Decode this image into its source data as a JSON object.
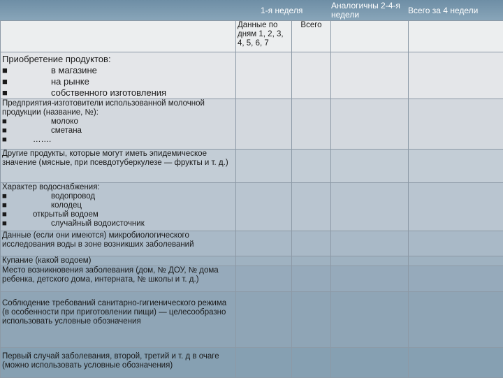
{
  "header": {
    "week1": "1-я неделя",
    "weeks2_4": "Аналогичны 2-4-я недели",
    "total4": "Всего за 4 недели"
  },
  "subheader": {
    "days": "Данные по дням 1, 2, 3, 4, 5, 6, 7",
    "total": "Всего"
  },
  "rows": {
    "purchase": {
      "title": "Приобретение продуктов:",
      "items": [
        "в магазине",
        "на рынке",
        "собственного изготовления"
      ]
    },
    "dairy": {
      "title": "Предприятия-изготовители использованной молочной продукции (название, №):",
      "items": [
        "молоко",
        "сметана",
        "……."
      ]
    },
    "other": {
      "title": "Другие продукты, которые могут иметь эпидемическое значение (мясные, при псевдотуберкулезе — фрукты и т. д.)"
    },
    "water": {
      "title": "Характер водоснабжения:",
      "items": [
        "водопровод",
        "колодец",
        "открытый водоем",
        "случайный водоисточник"
      ],
      "note": "Данные (если они имеются) микробиологического исследования воды в зоне возникших заболеваний"
    },
    "bathing": {
      "title": "Купание (какой водоем)"
    },
    "place": {
      "title": "Место возникновения заболевания (дом, № ДОУ, № дома ребенка, детского дома, интерната, № школы и т. д.)"
    },
    "hygiene": {
      "title": "Соблюдение требований санитарно-гигиенического режима (в особенности при приготовлении пищи) — целесообразно использовать условные обозначения"
    },
    "first_case": {
      "title": "Первый случай заболевания, второй, третий и т. д в очаге (можно использовать условные обозначения)"
    }
  },
  "bullet_symbol": "■"
}
